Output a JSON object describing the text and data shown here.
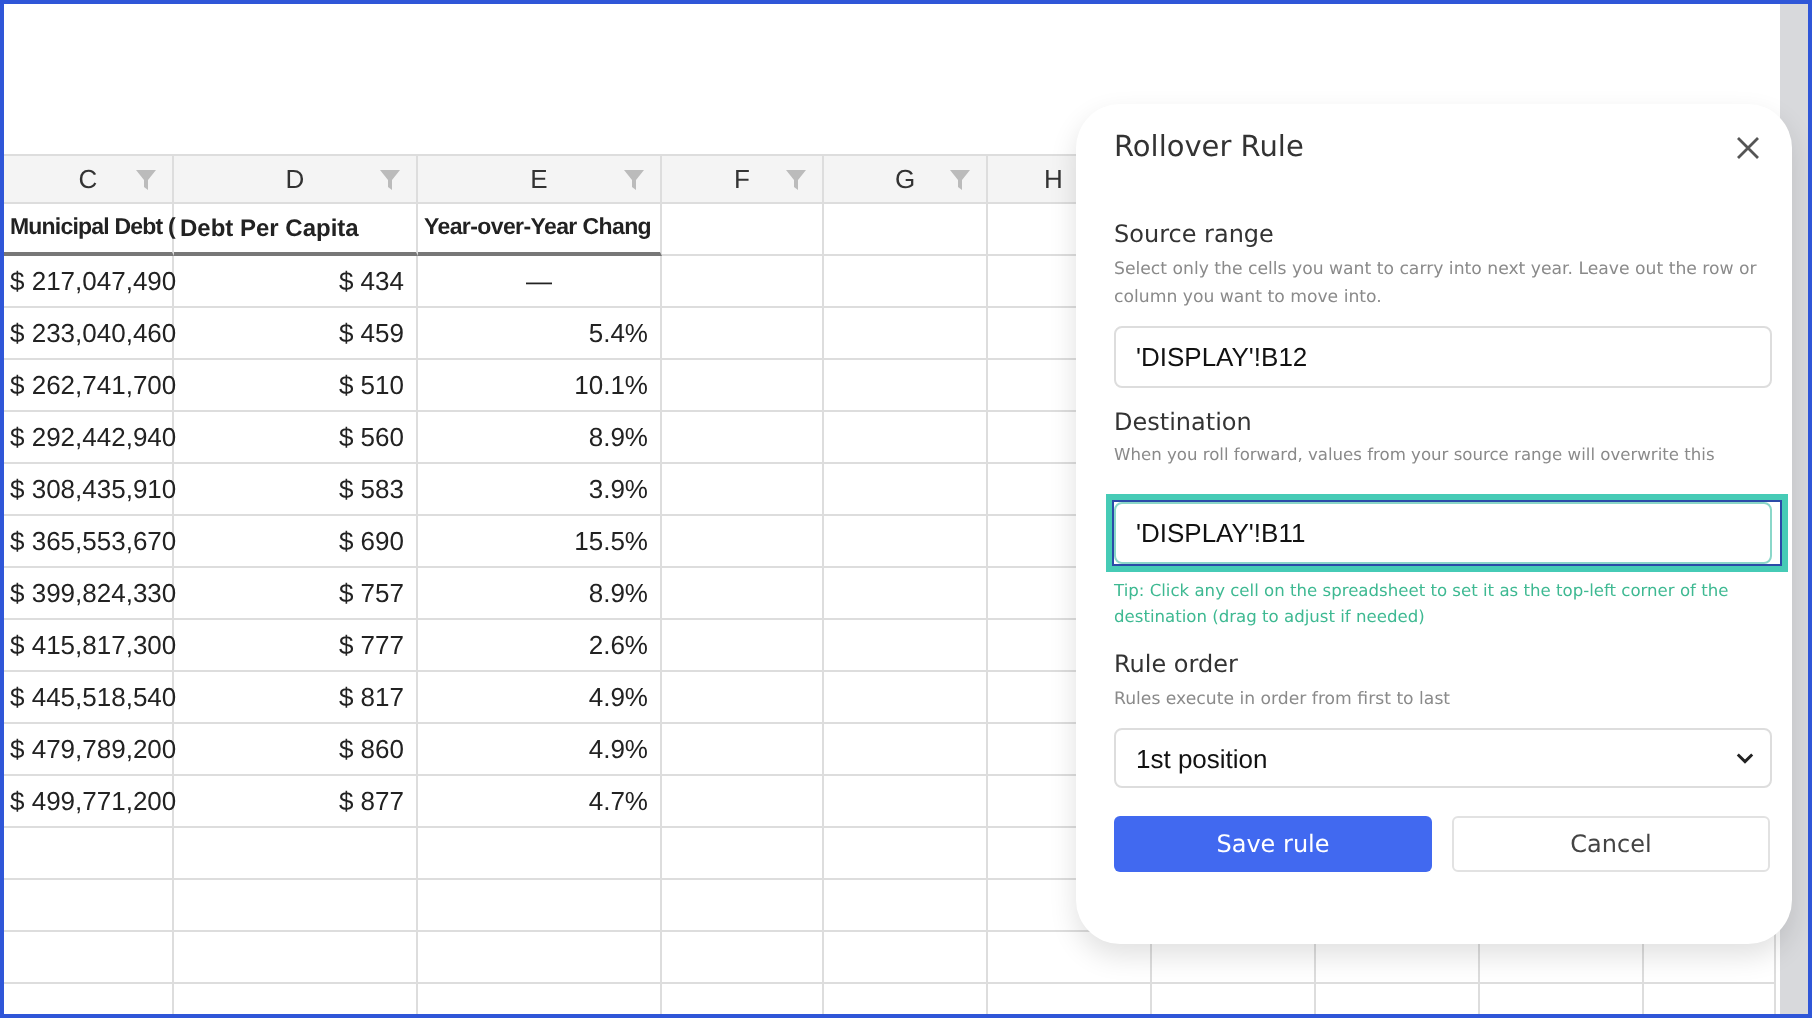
{
  "sheet": {
    "columns": [
      {
        "letter": "C",
        "filter": true
      },
      {
        "letter": "D",
        "filter": true
      },
      {
        "letter": "E",
        "filter": true
      },
      {
        "letter": "F",
        "filter": true
      },
      {
        "letter": "G",
        "filter": true
      },
      {
        "letter": "H",
        "filter": false
      }
    ],
    "headers": [
      "Municipal Debt (",
      "Debt Per Capita",
      "Year-over-Year Chang"
    ],
    "rows": [
      {
        "municipal_debt": "$ 217,047,490",
        "debt_per_capita": "$ 434",
        "yoy_change": "—"
      },
      {
        "municipal_debt": "$ 233,040,460",
        "debt_per_capita": "$ 459",
        "yoy_change": "5.4%"
      },
      {
        "municipal_debt": "$ 262,741,700",
        "debt_per_capita": "$ 510",
        "yoy_change": "10.1%"
      },
      {
        "municipal_debt": "$ 292,442,940",
        "debt_per_capita": "$ 560",
        "yoy_change": "8.9%"
      },
      {
        "municipal_debt": "$ 308,435,910",
        "debt_per_capita": "$ 583",
        "yoy_change": "3.9%"
      },
      {
        "municipal_debt": "$ 365,553,670",
        "debt_per_capita": "$ 690",
        "yoy_change": "15.5%"
      },
      {
        "municipal_debt": "$ 399,824,330",
        "debt_per_capita": "$ 757",
        "yoy_change": "8.9%"
      },
      {
        "municipal_debt": "$ 415,817,300",
        "debt_per_capita": "$ 777",
        "yoy_change": "2.6%"
      },
      {
        "municipal_debt": "$ 445,518,540",
        "debt_per_capita": "$ 817",
        "yoy_change": "4.9%"
      },
      {
        "municipal_debt": "$ 479,789,200",
        "debt_per_capita": "$ 860",
        "yoy_change": "4.9%"
      },
      {
        "municipal_debt": "$ 499,771,200",
        "debt_per_capita": "$ 877",
        "yoy_change": "4.7%"
      }
    ]
  },
  "dialog": {
    "title": "Rollover Rule",
    "source": {
      "label": "Source range",
      "help": "Select only the cells you want to carry into next year. Leave out the row or column you want to move into.",
      "value": "'DISPLAY'!B12"
    },
    "destination": {
      "label": "Destination",
      "help": "When you roll forward, values from your source range will overwrite this",
      "value": "'DISPLAY'!B11",
      "highlighted": true,
      "tip": "Tip: Click any cell on the spreadsheet to set it as the top-left corner of the destination (drag to adjust if needed)"
    },
    "rule_order": {
      "label": "Rule order",
      "help": "Rules execute in order from first to last",
      "value": "1st position"
    },
    "buttons": [
      {
        "label": "Save rule",
        "kind": "primary"
      },
      {
        "label": "Cancel",
        "kind": "secondary"
      }
    ]
  }
}
